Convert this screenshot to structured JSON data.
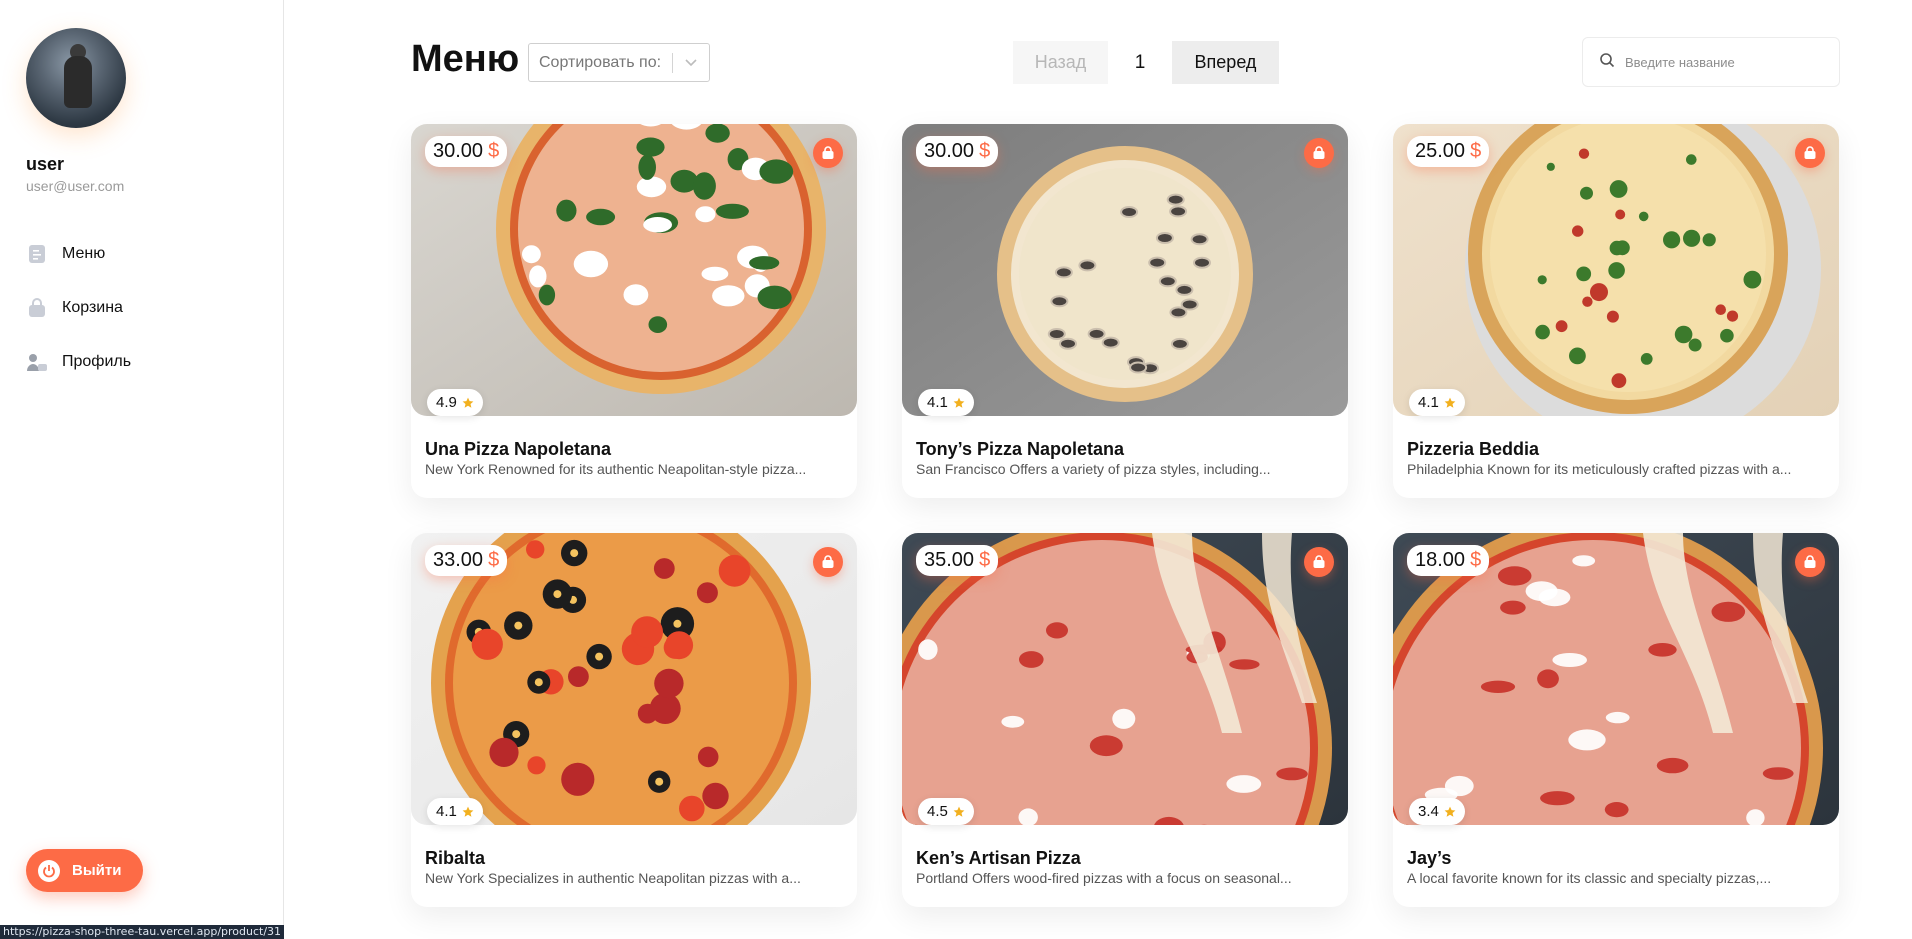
{
  "user": {
    "name": "user",
    "email": "user@user.com"
  },
  "sidebar": {
    "items": [
      {
        "label": "Меню",
        "icon": "menu-icon"
      },
      {
        "label": "Корзина",
        "icon": "bag-icon"
      },
      {
        "label": "Профиль",
        "icon": "profile-icon"
      }
    ],
    "logout_label": "Выйти"
  },
  "header": {
    "title": "Меню",
    "sort_placeholder": "Сортировать по:",
    "search_placeholder": "Введите название"
  },
  "pagination": {
    "prev_label": "Назад",
    "page": "1",
    "next_label": "Вперед"
  },
  "colors": {
    "accent": "#fd6b46",
    "star": "#f2b01e"
  },
  "products": [
    {
      "price": "30.00",
      "currency": "$",
      "rating": "4.9",
      "title": "Una Pizza Napoletana",
      "description": "New York Renowned for its authentic Neapolitan-style pizza..."
    },
    {
      "price": "30.00",
      "currency": "$",
      "rating": "4.1",
      "title": "Tony’s Pizza Napoletana",
      "description": "San Francisco Offers a variety of pizza styles, including..."
    },
    {
      "price": "25.00",
      "currency": "$",
      "rating": "4.1",
      "title": "Pizzeria Beddia",
      "description": "Philadelphia Known for its meticulously crafted pizzas with a..."
    },
    {
      "price": "33.00",
      "currency": "$",
      "rating": "4.1",
      "title": "Ribalta",
      "description": "New York Specializes in authentic Neapolitan pizzas with a..."
    },
    {
      "price": "35.00",
      "currency": "$",
      "rating": "4.5",
      "title": "Ken’s Artisan Pizza",
      "description": "Portland Offers wood-fired pizzas with a focus on seasonal..."
    },
    {
      "price": "18.00",
      "currency": "$",
      "rating": "3.4",
      "title": "Jay’s",
      "description": "A local favorite known for its classic and specialty pizzas,..."
    }
  ],
  "status_bar_url": "https://pizza-shop-three-tau.vercel.app/product/31"
}
